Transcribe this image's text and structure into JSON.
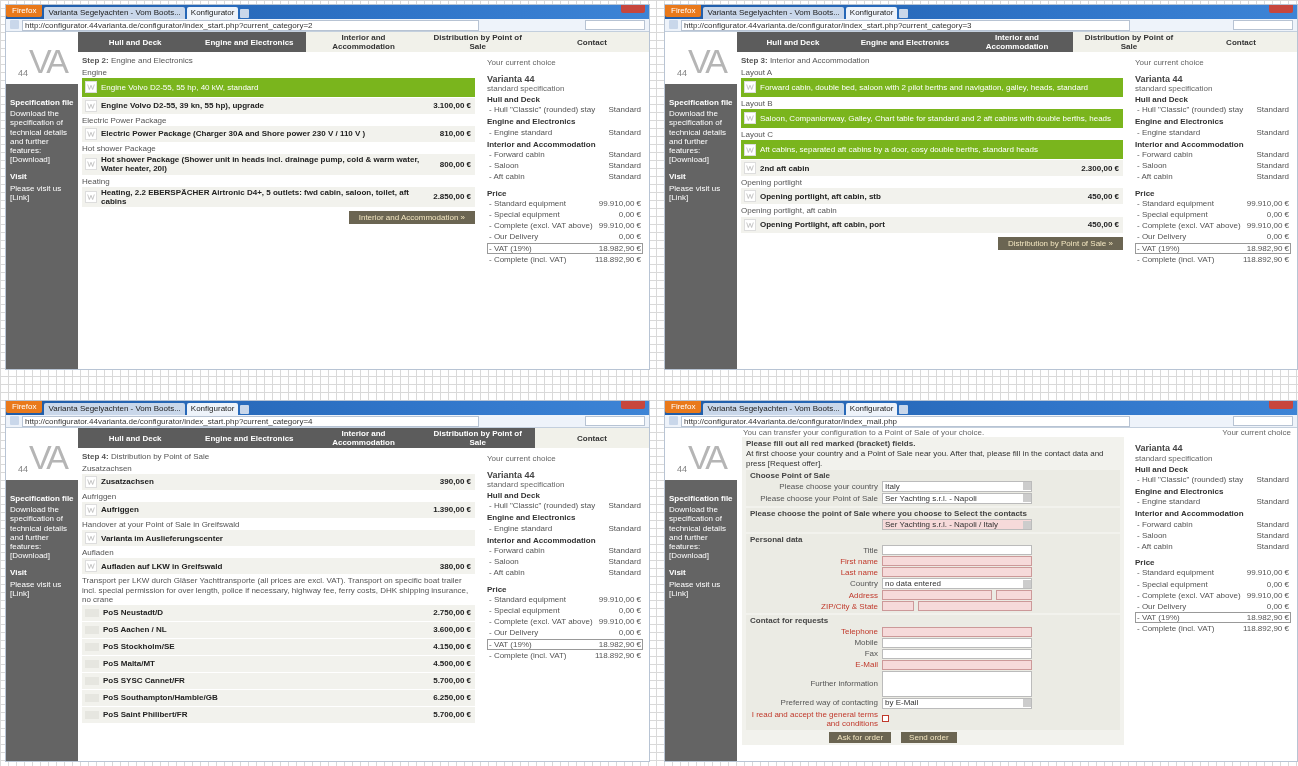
{
  "panels": [
    {
      "kind": "configurator",
      "browser": {
        "button": "Firefox",
        "tabs": [
          {
            "label": "Varianta Segelyachten - Vom Boots...",
            "selected": false
          },
          {
            "label": "Konfigurator",
            "selected": true
          }
        ],
        "url": "http://configurator.44varianta.de/configurator/index_start.php?current_category=2"
      },
      "logo": {
        "number": "44",
        "letters": "VA"
      },
      "sidebar": {
        "heading": "Specification file",
        "text": "Download the specification of technical details and further features:",
        "link": "[Download]",
        "visit_heading": "Visit",
        "visit_text": "Please visit us",
        "visit_link": "[Link]"
      },
      "nav": [
        {
          "label": "Hull and Deck",
          "done": true
        },
        {
          "label": "Engine and Electronics",
          "done": true
        },
        {
          "label": "Interior and Accommodation",
          "done": false
        },
        {
          "label": "Distribution by Point of Sale",
          "done": false
        },
        {
          "label": "Contact",
          "done": false
        }
      ],
      "step": {
        "number": "Step 2:",
        "title": "Engine and Electronics"
      },
      "groups": [
        {
          "title": "Engine",
          "items": [
            {
              "kind": "option",
              "text": "Engine Volvo D2-55, 55 hp, 40 kW, standard",
              "selected": true
            },
            {
              "kind": "option",
              "text": "Engine Volvo D2-55, 39 kn, 55 hp), upgrade",
              "price": "3.100,00 €",
              "selected": false
            }
          ]
        },
        {
          "title": "Electric Power Package",
          "items": [
            {
              "kind": "option",
              "text": "Electric Power Package (Charger 30A and Shore power 230 V / 110 V )",
              "price": "810,00 €",
              "selected": false
            }
          ]
        },
        {
          "title": "Hot shower Package",
          "items": [
            {
              "kind": "option",
              "text": "Hot shower Package (Shower unit in heads incl. drainage pump, cold & warm water, Water heater, 20l)",
              "price": "800,00 €",
              "selected": false
            }
          ]
        },
        {
          "title": "Heating",
          "items": [
            {
              "kind": "option",
              "text": "Heating, 2.2 EBERSPÄCHER Airtronic D4+, 5 outlets: fwd cabin, saloon, toilet, aft cabins",
              "price": "2.850,00 €",
              "selected": false
            }
          ]
        }
      ],
      "button": "Interior and Accommodation »",
      "summary": {
        "title": "Your current choice",
        "name": "Varianta 44",
        "subtitle": "standard specification",
        "sections": [
          {
            "heading": "Hull and Deck",
            "lines": [
              {
                "label": "- Hull \"Classic\" (rounded) stay",
                "value": "Standard",
                "outlined": false
              }
            ]
          },
          {
            "heading": "Engine and Electronics",
            "lines": [
              {
                "label": "- Engine standard",
                "value": "Standard",
                "outlined": false
              }
            ]
          },
          {
            "heading": "Interior and Accommodation",
            "lines": [
              {
                "label": "- Forward cabin",
                "value": "Standard",
                "outlined": false
              },
              {
                "label": "- Saloon",
                "value": "Standard",
                "outlined": false
              },
              {
                "label": "- Aft cabin",
                "value": "Standard",
                "outlined": false
              }
            ]
          },
          {
            "heading": "Price",
            "lines": [
              {
                "label": "- Standard equipment",
                "value": "99.910,00 €",
                "outlined": false
              },
              {
                "label": "- Special equipment",
                "value": "0,00 €",
                "outlined": false
              },
              {
                "label": "- Complete (excl. VAT above)",
                "value": "99.910,00 €",
                "outlined": false
              },
              {
                "label": "- Our Delivery",
                "value": "0,00 €",
                "outlined": false
              },
              {
                "label": "- VAT (19%)",
                "value": "18.982,90 €",
                "outlined": true
              },
              {
                "label": "- Complete (incl. VAT)",
                "value": "118.892,90 €",
                "outlined": false
              }
            ]
          }
        ]
      }
    },
    {
      "kind": "configurator",
      "browser": {
        "button": "Firefox",
        "tabs": [
          {
            "label": "Varianta Segelyachten - Vom Boots...",
            "selected": false
          },
          {
            "label": "Konfigurator",
            "selected": true
          }
        ],
        "url": "http://configurator.44varianta.de/configurator/index_start.php?current_category=3"
      },
      "logo": {
        "number": "44",
        "letters": "VA"
      },
      "sidebar": {
        "heading": "Specification file",
        "text": "Download the specification of technical details and further features:",
        "link": "[Download]",
        "visit_heading": "Visit",
        "visit_text": "Please visit us",
        "visit_link": "[Link]"
      },
      "nav": [
        {
          "label": "Hull and Deck",
          "done": true
        },
        {
          "label": "Engine and Electronics",
          "done": true
        },
        {
          "label": "Interior and Accommodation",
          "done": true
        },
        {
          "label": "Distribution by Point of Sale",
          "done": false
        },
        {
          "label": "Contact",
          "done": false
        }
      ],
      "step": {
        "number": "Step 3:",
        "title": "Interior and Accommodation"
      },
      "groups": [
        {
          "title": "Layout A",
          "items": [
            {
              "kind": "option",
              "text": "Forward cabin, double bed, saloon with 2 pilot berths and navigation, galley, heads, standard",
              "selected": true
            }
          ]
        },
        {
          "title": "Layout B",
          "items": [
            {
              "kind": "option",
              "text": "Saloon, Companionway, Galley, Chart table for standard and 2 aft cabins with double berths, heads",
              "selected": true
            }
          ]
        },
        {
          "title": "Layout C",
          "items": [
            {
              "kind": "option",
              "text": "Aft cabins, separated aft cabins by a door, cosy double berths, standard heads",
              "selected": true
            },
            {
              "kind": "option",
              "text": "2nd aft cabin",
              "price": "2.300,00 €",
              "selected": false
            }
          ]
        },
        {
          "title": "Opening portlight",
          "items": [
            {
              "kind": "option",
              "text": "Opening portlight, aft cabin, stb",
              "price": "450,00 €",
              "selected": false
            }
          ]
        },
        {
          "title": "Opening portlight, aft cabin",
          "items": [
            {
              "kind": "option",
              "text": "Opening Portlight, aft cabin, port",
              "price": "450,00 €",
              "selected": false
            }
          ]
        }
      ],
      "button": "Distribution by Point of Sale »",
      "summary": {
        "title": "Your current choice",
        "name": "Varianta 44",
        "subtitle": "standard specification",
        "sections": [
          {
            "heading": "Hull and Deck",
            "lines": [
              {
                "label": "- Hull \"Classic\" (rounded) stay",
                "value": "Standard",
                "outlined": false
              }
            ]
          },
          {
            "heading": "Engine and Electronics",
            "lines": [
              {
                "label": "- Engine standard",
                "value": "Standard",
                "outlined": false
              }
            ]
          },
          {
            "heading": "Interior and Accommodation",
            "lines": [
              {
                "label": "- Forward cabin",
                "value": "Standard",
                "outlined": false
              },
              {
                "label": "- Saloon",
                "value": "Standard",
                "outlined": false
              },
              {
                "label": "- Aft cabin",
                "value": "Standard",
                "outlined": false
              }
            ]
          },
          {
            "heading": "Price",
            "lines": [
              {
                "label": "- Standard equipment",
                "value": "99.910,00 €",
                "outlined": false
              },
              {
                "label": "- Special equipment",
                "value": "0,00 €",
                "outlined": false
              },
              {
                "label": "- Complete (excl. VAT above)",
                "value": "99.910,00 €",
                "outlined": false
              },
              {
                "label": "- Our Delivery",
                "value": "0,00 €",
                "outlined": false
              },
              {
                "label": "- VAT (19%)",
                "value": "18.982,90 €",
                "outlined": true
              },
              {
                "label": "- Complete (incl. VAT)",
                "value": "118.892,90 €",
                "outlined": false
              }
            ]
          }
        ]
      }
    },
    {
      "kind": "configurator",
      "browser": {
        "button": "Firefox",
        "tabs": [
          {
            "label": "Varianta Segelyachten - Vom Boots...",
            "selected": false
          },
          {
            "label": "Konfigurator",
            "selected": true
          }
        ],
        "url": "http://configurator.44varianta.de/configurator/index_start.php?current_category=4"
      },
      "logo": {
        "number": "44",
        "letters": "VA"
      },
      "sidebar": {
        "heading": "Specification file",
        "text": "Download the specification of technical details and further features:",
        "link": "[Download]",
        "visit_heading": "Visit",
        "visit_text": "Please visit us",
        "visit_link": "[Link]"
      },
      "nav": [
        {
          "label": "Hull and Deck",
          "done": true
        },
        {
          "label": "Engine and Electronics",
          "done": true
        },
        {
          "label": "Interior and Accommodation",
          "done": true
        },
        {
          "label": "Distribution by Point of Sale",
          "done": true
        },
        {
          "label": "Contact",
          "done": false
        }
      ],
      "step": {
        "number": "Step 4:",
        "title": "Distribution by Point of Sale"
      },
      "groups": [
        {
          "title": "Zusatzachsen",
          "items": [
            {
              "kind": "option",
              "text": "Zusatzachsen",
              "price": "390,00 €",
              "selected": false
            }
          ]
        },
        {
          "title": "Aufriggen",
          "items": [
            {
              "kind": "option",
              "text": "Aufriggen",
              "price": "1.390,00 €",
              "selected": false
            }
          ]
        },
        {
          "title": "Handover at your Point of Sale in Greifswald",
          "items": [
            {
              "kind": "option",
              "text": "Varianta im Auslieferungscenter",
              "selected": false
            }
          ]
        },
        {
          "title": "Aufladen",
          "items": [
            {
              "kind": "option",
              "text": "Aufladen auf LKW in Greifswald",
              "price": "380,00 €",
              "selected": false
            }
          ]
        },
        {
          "title": "Transport per LKW durch Gläser Yachttransporte (all prices are excl. VAT). Transport on specific boat trailer incl. special permission for over length, police if necessary, highway fee, ferry costs, DHK shipping insurance, no crane",
          "items": [
            {
              "kind": "transport",
              "text": "PoS Neustadt/D",
              "price": "2.750,00 €",
              "selected": false
            },
            {
              "kind": "transport",
              "text": "PoS Aachen / NL",
              "price": "3.600,00 €",
              "selected": false
            },
            {
              "kind": "transport",
              "text": "PoS Stockholm/SE",
              "price": "4.150,00 €",
              "selected": false
            },
            {
              "kind": "transport",
              "text": "PoS Malta/MT",
              "price": "4.500,00 €",
              "selected": false
            },
            {
              "kind": "transport",
              "text": "PoS SYSC Cannet/FR",
              "price": "5.700,00 €",
              "selected": false
            },
            {
              "kind": "transport",
              "text": "PoS Southampton/Hamble/GB",
              "price": "6.250,00 €",
              "selected": false
            },
            {
              "kind": "transport",
              "text": "PoS Saint Philibert/FR",
              "price": "5.700,00 €",
              "selected": false
            }
          ]
        }
      ],
      "summary": {
        "title": "Your current choice",
        "name": "Varianta 44",
        "subtitle": "standard specification",
        "sections": [
          {
            "heading": "Hull and Deck",
            "lines": [
              {
                "label": "- Hull \"Classic\" (rounded) stay",
                "value": "Standard",
                "outlined": false
              }
            ]
          },
          {
            "heading": "Engine and Electronics",
            "lines": [
              {
                "label": "- Engine standard",
                "value": "Standard",
                "outlined": false
              }
            ]
          },
          {
            "heading": "Interior and Accommodation",
            "lines": [
              {
                "label": "- Forward cabin",
                "value": "Standard",
                "outlined": false
              },
              {
                "label": "- Saloon",
                "value": "Standard",
                "outlined": false
              },
              {
                "label": "- Aft cabin",
                "value": "Standard",
                "outlined": false
              }
            ]
          },
          {
            "heading": "Price",
            "lines": [
              {
                "label": "- Standard equipment",
                "value": "99.910,00 €",
                "outlined": false
              },
              {
                "label": "- Special equipment",
                "value": "0,00 €",
                "outlined": false
              },
              {
                "label": "- Complete (excl. VAT above)",
                "value": "99.910,00 €",
                "outlined": false
              },
              {
                "label": "- Our Delivery",
                "value": "0,00 €",
                "outlined": false
              },
              {
                "label": "- VAT (19%)",
                "value": "18.982,90 €",
                "outlined": true
              },
              {
                "label": "- Complete (incl. VAT)",
                "value": "118.892,90 €",
                "outlined": false
              }
            ]
          }
        ]
      }
    },
    {
      "kind": "form",
      "browser": {
        "button": "Firefox",
        "tabs": [
          {
            "label": "Varianta Segelyachten - Vom Boots...",
            "selected": false
          },
          {
            "label": "Konfigurator",
            "selected": true
          }
        ],
        "url": "http://configurator.44varianta.de/configurator/index_mail.php"
      },
      "logo": {
        "number": "44",
        "letters": "VA"
      },
      "sidebar": {
        "heading": "Specification file",
        "text": "Download the specification of technical details and further features:",
        "link": "[Download]",
        "visit_heading": "Visit",
        "visit_text": "Please visit us",
        "visit_link": "[Link]"
      },
      "top_note": "You can transfer your configuration to a Point of Sale of your choice.",
      "form": {
        "intro": "Please fill out all red marked (bracket) fields.",
        "instructions": "At first choose your country and a Point of Sale near you. After that, please fill in the contact data and press [Request offer].",
        "fieldsets": [
          {
            "legend": "Choose Point of Sale",
            "fields": [
              {
                "kind": "select",
                "label": "Please choose your country",
                "value": "Italy",
                "required": false
              },
              {
                "kind": "select",
                "label": "Please choose your Point of Sale",
                "value": "Ser Yachting s.r.l. - Napoli",
                "required": false
              }
            ]
          },
          {
            "legend": "Please choose the point of Sale where you choose to Select the contacts",
            "fields": [
              {
                "kind": "select",
                "value": "Ser Yachting s.r.l. - Napoli / Italy",
                "required": true
              }
            ]
          },
          {
            "legend": "Personal data",
            "fields": [
              {
                "kind": "text",
                "label": "Title",
                "required": false
              },
              {
                "kind": "text",
                "label": "First name",
                "required": true
              },
              {
                "kind": "text",
                "label": "Last name",
                "required": true
              },
              {
                "kind": "select",
                "label": "Country",
                "value": "no data entered",
                "required": false
              },
              {
                "kind": "address",
                "label": "Address",
                "required": true
              },
              {
                "kind": "zipcity",
                "label": "ZIP/City & State",
                "required": true
              }
            ]
          },
          {
            "legend": "Contact for requests",
            "fields": [
              {
                "kind": "text",
                "label": "Telephone",
                "required": true
              },
              {
                "kind": "text",
                "label": "Mobile",
                "required": false
              },
              {
                "kind": "text",
                "label": "Fax",
                "required": false
              },
              {
                "kind": "text",
                "label": "E-Mail",
                "required": true
              },
              {
                "kind": "textarea",
                "label": "Further information",
                "required": false
              },
              {
                "kind": "select",
                "label": "Preferred way of contacting",
                "value": "by E-Mail",
                "required": false
              },
              {
                "kind": "checkbox",
                "label": "I read and accept the general terms and conditions",
                "checked": false,
                "required": true
              }
            ]
          }
        ],
        "buttons": [
          "Ask for order",
          "Send order"
        ]
      },
      "summary": {
        "title": "Your current choice",
        "name": "Varianta 44",
        "subtitle": "standard specification",
        "sections": [
          {
            "heading": "Hull and Deck",
            "lines": [
              {
                "label": "- Hull \"Classic\" (rounded) stay",
                "value": "Standard",
                "outlined": false
              }
            ]
          },
          {
            "heading": "Engine and Electronics",
            "lines": [
              {
                "label": "- Engine standard",
                "value": "Standard",
                "outlined": false
              }
            ]
          },
          {
            "heading": "Interior and Accommodation",
            "lines": [
              {
                "label": "- Forward cabin",
                "value": "Standard",
                "outlined": false
              },
              {
                "label": "- Saloon",
                "value": "Standard",
                "outlined": false
              },
              {
                "label": "- Aft cabin",
                "value": "Standard",
                "outlined": false
              }
            ]
          },
          {
            "heading": "Price",
            "lines": [
              {
                "label": "- Standard equipment",
                "value": "99.910,00 €",
                "outlined": false
              },
              {
                "label": "- Special equipment",
                "value": "0,00 €",
                "outlined": false
              },
              {
                "label": "- Complete (excl. VAT above)",
                "value": "99.910,00 €",
                "outlined": false
              },
              {
                "label": "- Our Delivery",
                "value": "0,00 €",
                "outlined": false
              },
              {
                "label": "- VAT (19%)",
                "value": "18.982,90 €",
                "outlined": true
              },
              {
                "label": "- Complete (incl. VAT)",
                "value": "118.892,90 €",
                "outlined": false
              }
            ]
          }
        ]
      }
    }
  ]
}
